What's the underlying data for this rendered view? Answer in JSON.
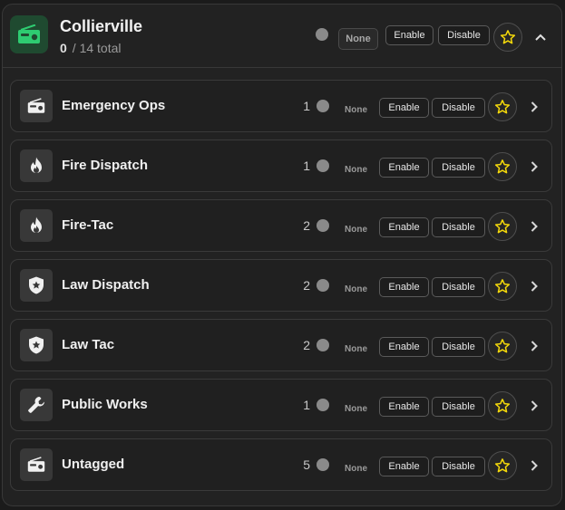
{
  "header": {
    "title": "Collierville",
    "active_count": "0",
    "total_text": "/ 14 total",
    "none_label": "None",
    "enable_label": "Enable",
    "disable_label": "Disable",
    "icon": "radio-icon",
    "collapse_icon": "chevron-up-icon",
    "accent_color": "#2ecc71"
  },
  "groups": [
    {
      "label": "Emergency Ops",
      "count": "1",
      "none_label": "None",
      "enable_label": "Enable",
      "disable_label": "Disable",
      "icon": "radio-icon"
    },
    {
      "label": "Fire Dispatch",
      "count": "1",
      "none_label": "None",
      "enable_label": "Enable",
      "disable_label": "Disable",
      "icon": "fire-icon"
    },
    {
      "label": "Fire-Tac",
      "count": "2",
      "none_label": "None",
      "enable_label": "Enable",
      "disable_label": "Disable",
      "icon": "fire-icon"
    },
    {
      "label": "Law Dispatch",
      "count": "2",
      "none_label": "None",
      "enable_label": "Enable",
      "disable_label": "Disable",
      "icon": "shield-star-icon"
    },
    {
      "label": "Law Tac",
      "count": "2",
      "none_label": "None",
      "enable_label": "Enable",
      "disable_label": "Disable",
      "icon": "shield-star-icon"
    },
    {
      "label": "Public Works",
      "count": "1",
      "none_label": "None",
      "enable_label": "Enable",
      "disable_label": "Disable",
      "icon": "wrench-icon"
    },
    {
      "label": "Untagged",
      "count": "5",
      "none_label": "None",
      "enable_label": "Enable",
      "disable_label": "Disable",
      "icon": "radio-icon"
    }
  ],
  "colors": {
    "star": "#f5d90a",
    "status_dot": "#8a8a8a"
  }
}
